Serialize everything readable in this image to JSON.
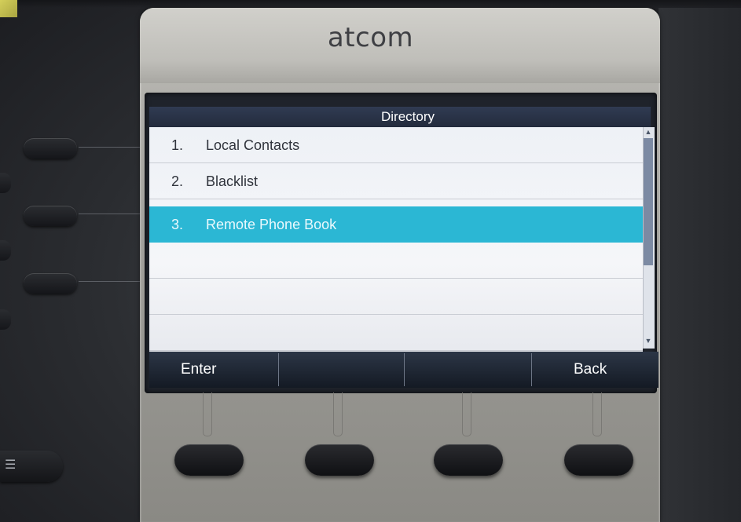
{
  "device": {
    "brand": "atcom"
  },
  "screen": {
    "title": "Directory",
    "menu_items": [
      {
        "number": "1.",
        "label": "Local Contacts",
        "selected": false
      },
      {
        "number": "2.",
        "label": "Blacklist",
        "selected": false
      },
      {
        "number": "3.",
        "label": "Remote Phone Book",
        "selected": true
      }
    ],
    "softkeys": {
      "left": "Enter",
      "middle_left": "",
      "middle_right": "",
      "right": "Back"
    }
  },
  "icons": {
    "scroll_up": "scroll-up-arrow-icon",
    "scroll_down": "scroll-down-arrow-icon",
    "menu_key": "menu-lines-icon"
  },
  "colors": {
    "selection_highlight": "#2bb7d4",
    "title_bar": "#2a3447",
    "softkey_bar": "#1c2330",
    "list_background": "#f1f3f7",
    "bezel_silver": "#b3b2ad"
  }
}
